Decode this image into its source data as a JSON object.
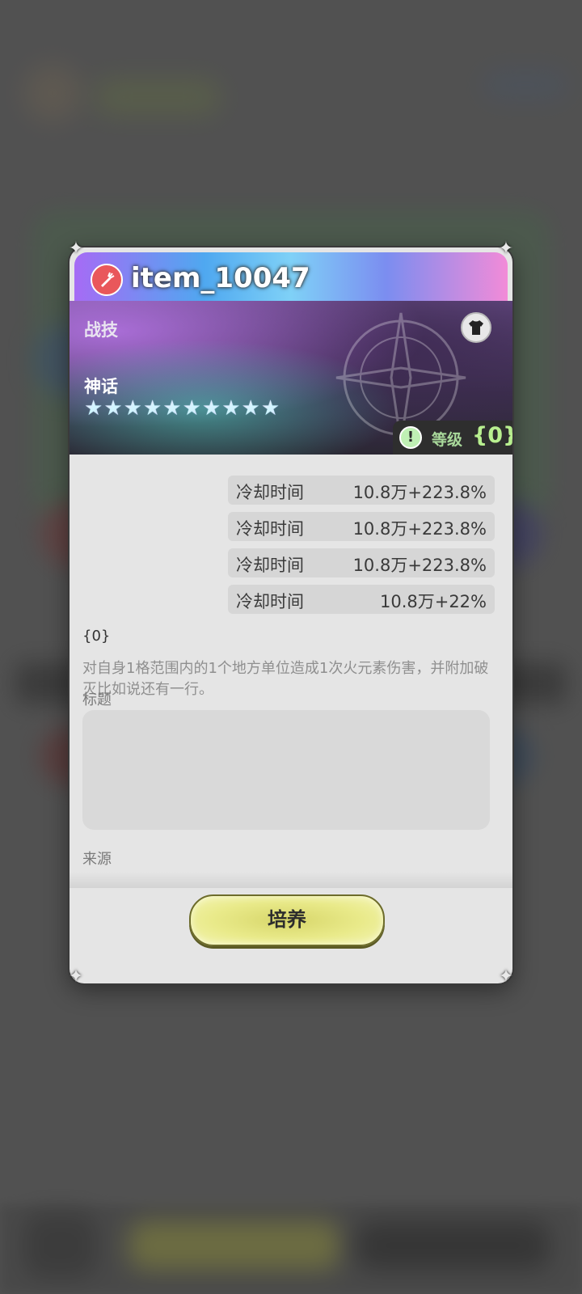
{
  "dialog": {
    "title": "item_10047",
    "category": "战技",
    "rarity": "神话",
    "stars": [
      "★",
      "★",
      "★",
      "★",
      "★",
      "★",
      "★",
      "★",
      "★",
      "★"
    ],
    "level_label": "等级",
    "level_value": "{0}",
    "stats": [
      {
        "name": "冷却时间",
        "value": "10.8万+223.8%"
      },
      {
        "name": "冷却时间",
        "value": "10.8万+223.8%"
      },
      {
        "name": "冷却时间",
        "value": "10.8万+223.8%"
      },
      {
        "name": "冷却时间",
        "value": "10.8万+22%"
      }
    ],
    "skill_tag": "{0}",
    "description": "对自身1格范围内的1个地方单位造成1次火元素伤害，并附加破灭比如说还有一行。",
    "section_title": "标题",
    "section_source": "来源",
    "train_button": "培养"
  },
  "colors": {
    "accent_green": "#b8ef8f",
    "button_yellow": "#e9ea8a",
    "item_icon": "#e9575b"
  },
  "icons": {
    "item": "carrot-icon",
    "equip": "shirt-icon",
    "warning": "exclamation-icon"
  }
}
